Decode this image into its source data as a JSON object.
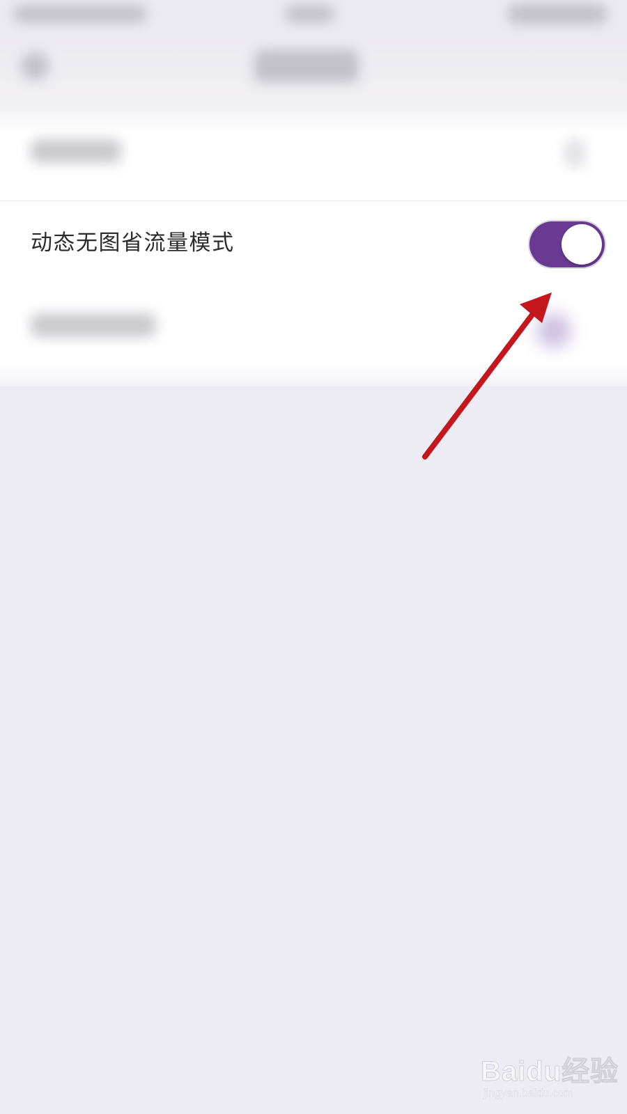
{
  "settings": {
    "items": [
      {
        "label": "动态无图省流量模式",
        "toggle_on": true
      }
    ]
  },
  "colors": {
    "accent": "#6a3a93",
    "annotation_arrow": "#c4171d",
    "background": "#edecf3"
  },
  "watermark": {
    "logo": "Baidu经验",
    "url": "jingyan.baidu.com"
  }
}
